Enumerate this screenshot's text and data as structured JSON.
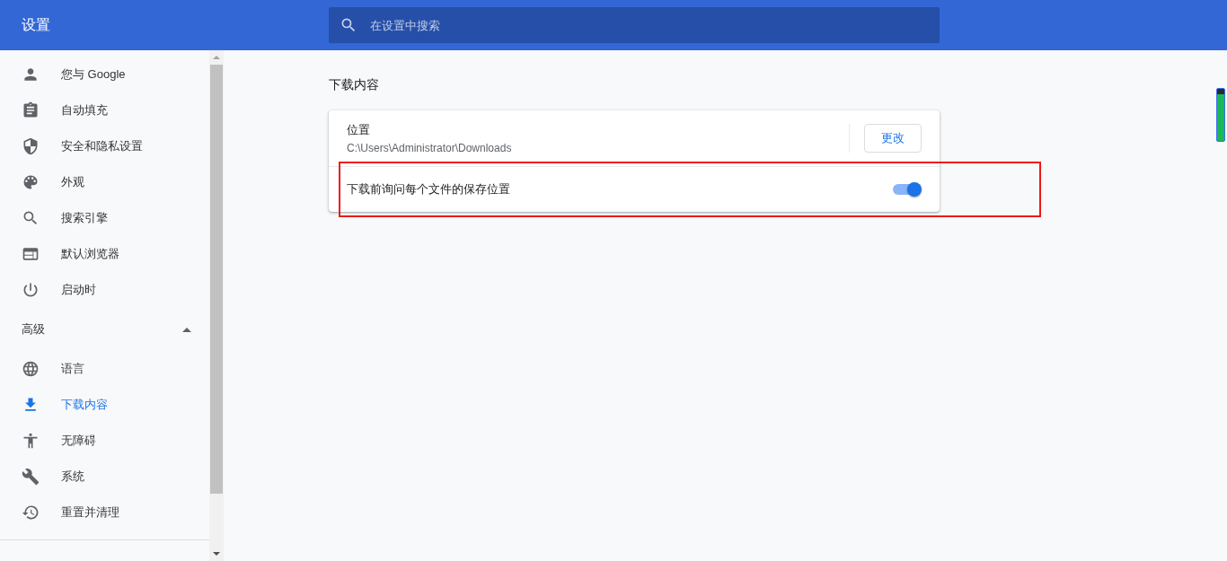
{
  "header": {
    "title": "设置",
    "search": {
      "placeholder": "在设置中搜索"
    }
  },
  "sidebar": {
    "items": [
      {
        "label": "您与 Google",
        "selected": false
      },
      {
        "label": "自动填充",
        "selected": false
      },
      {
        "label": "安全和隐私设置",
        "selected": false
      },
      {
        "label": "外观",
        "selected": false
      },
      {
        "label": "搜索引擎",
        "selected": false
      },
      {
        "label": "默认浏览器",
        "selected": false
      },
      {
        "label": "启动时",
        "selected": false
      }
    ],
    "advanced": {
      "label": "高级",
      "expanded": true,
      "items": [
        {
          "label": "语言",
          "selected": false
        },
        {
          "label": "下载内容",
          "selected": true
        },
        {
          "label": "无障碍",
          "selected": false
        },
        {
          "label": "系统",
          "selected": false
        },
        {
          "label": "重置并清理",
          "selected": false
        }
      ]
    }
  },
  "section": {
    "title": "下载内容",
    "location": {
      "label": "位置",
      "path": "C:\\Users\\Administrator\\Downloads",
      "button": "更改"
    },
    "ask_toggle": {
      "label": "下载前询问每个文件的保存位置",
      "on": true
    }
  }
}
